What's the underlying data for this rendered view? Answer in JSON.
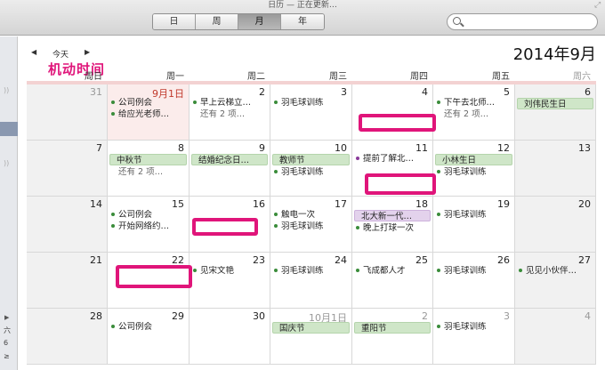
{
  "window": {
    "title": "日历 — 正在更新…"
  },
  "toolbar": {
    "views": [
      "日",
      "周",
      "月",
      "年"
    ],
    "active_view": 2
  },
  "search": {
    "placeholder": ""
  },
  "nav": {
    "prev_icon": "triangle-left-icon",
    "today_label": "今天",
    "next_icon": "triangle-right-icon"
  },
  "annotation": {
    "label": "机动时间"
  },
  "header": {
    "month_title": "2014年9月"
  },
  "weekdays": [
    "周日",
    "周一",
    "周二",
    "周三",
    "周四",
    "周五",
    "周六"
  ],
  "sidebar": {
    "labels": [
      "六",
      "6",
      "≥"
    ]
  },
  "weeks": [
    [
      {
        "day": "31",
        "dim": true
      },
      {
        "day": "9月1日",
        "red": true,
        "today": true,
        "events": [
          "公司例会",
          "给应光老师…"
        ]
      },
      {
        "day": "2",
        "events": [
          "早上云梯立…"
        ],
        "more": "还有 2 项…"
      },
      {
        "day": "3",
        "events": [
          "羽毛球训练"
        ]
      },
      {
        "day": "4",
        "redact": true
      },
      {
        "day": "5",
        "events": [
          "下午去北师…"
        ],
        "more": "还有 2 项…"
      },
      {
        "day": "6",
        "allday": "刘伟民生日"
      }
    ],
    [
      {
        "day": "7"
      },
      {
        "day": "8",
        "allday": "中秋节",
        "more": "还有 2 项…"
      },
      {
        "day": "9",
        "allday": "结婚纪念日…"
      },
      {
        "day": "10",
        "allday": "教师节",
        "events": [
          "羽毛球训练"
        ]
      },
      {
        "day": "11",
        "events_purple": [
          "提前了解北…"
        ],
        "redact": true
      },
      {
        "day": "12",
        "allday": "小林生日",
        "events": [
          "羽毛球训练"
        ]
      },
      {
        "day": "13"
      }
    ],
    [
      {
        "day": "14"
      },
      {
        "day": "15",
        "events": [
          "公司例会",
          "开始网络约…"
        ]
      },
      {
        "day": "16",
        "redact": true
      },
      {
        "day": "17",
        "events": [
          "触电一次",
          "羽毛球训练"
        ]
      },
      {
        "day": "18",
        "allday_purple": "北大新一代…",
        "events": [
          "晚上打球一次"
        ]
      },
      {
        "day": "19",
        "events": [
          "羽毛球训练"
        ]
      },
      {
        "day": "20"
      }
    ],
    [
      {
        "day": "21"
      },
      {
        "day": "22",
        "redact": true
      },
      {
        "day": "23",
        "events": [
          "见宋文艳"
        ]
      },
      {
        "day": "24",
        "events": [
          "羽毛球训练"
        ]
      },
      {
        "day": "25",
        "events": [
          "飞成都人才"
        ]
      },
      {
        "day": "26",
        "events": [
          "羽毛球训练"
        ]
      },
      {
        "day": "27",
        "events": [
          "见见小伙伴…"
        ]
      }
    ],
    [
      {
        "day": "28"
      },
      {
        "day": "29",
        "events": [
          "公司例会"
        ]
      },
      {
        "day": "30"
      },
      {
        "day": "10月1日",
        "dim": true,
        "allday": "国庆节"
      },
      {
        "day": "2",
        "dim": true,
        "allday": "重阳节"
      },
      {
        "day": "3",
        "dim": true,
        "events": [
          "羽毛球训练"
        ]
      },
      {
        "day": "4",
        "dim": true
      }
    ]
  ]
}
